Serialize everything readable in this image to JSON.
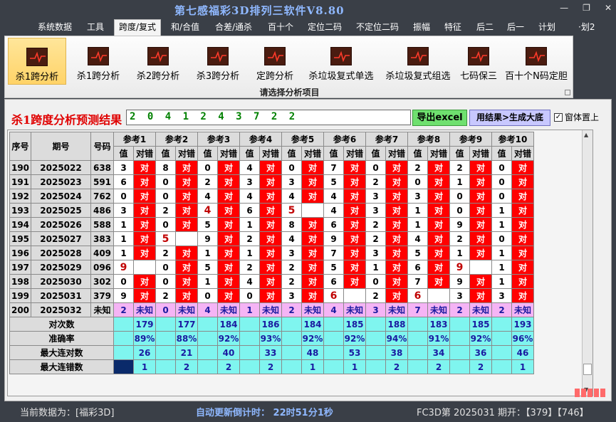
{
  "app_title": "第七感福彩3D排列三软件V8.80",
  "window_controls": [
    "—",
    "❐",
    "✕"
  ],
  "menu": [
    "系统数据",
    "工具",
    "跨度/复式",
    "和/合值",
    "合差/通杀",
    "百十个",
    "定位二码",
    "不定位二码",
    "振幅",
    "特征",
    "后二",
    "后一",
    "计划",
    "·划2"
  ],
  "active_menu_index": 2,
  "ribbon": {
    "buttons": [
      "杀1跨分析",
      "杀1跨分析",
      "杀2跨分析",
      "杀3跨分析",
      "定跨分析",
      "杀垃圾复式单选",
      "杀垃圾复式组选",
      "七码保三",
      "百十个N码定胆"
    ],
    "active_index": 0,
    "caption": "请选择分析项目"
  },
  "result": {
    "title": "杀1跨度分析预测结果",
    "value": "2 0 4 1 2 4 3 7 2 2",
    "export_button": "导出excel",
    "generate_button": "用结果>生成大底",
    "topmost_label": "窗体置上",
    "topmost_checked": true
  },
  "table": {
    "col_serial": "序号",
    "col_period": "期号",
    "col_number": "号码",
    "ref_headers": [
      "参考1",
      "参考2",
      "参考3",
      "参考4",
      "参考5",
      "参考6",
      "参考7",
      "参考8",
      "参考9",
      "参考10"
    ],
    "sub_value": "值",
    "sub_result": "对错",
    "ok_text": "对",
    "rows": [
      {
        "seq": "190",
        "period": "2025022",
        "num": "638",
        "vals": [
          "3",
          "8",
          "0",
          "4",
          "0",
          "7",
          "0",
          "2",
          "2",
          "0"
        ],
        "ok": [
          true,
          true,
          true,
          true,
          true,
          true,
          true,
          true,
          true,
          true
        ]
      },
      {
        "seq": "191",
        "period": "2025023",
        "num": "591",
        "vals": [
          "6",
          "0",
          "2",
          "3",
          "3",
          "5",
          "2",
          "0",
          "1",
          "0"
        ],
        "ok": [
          true,
          true,
          true,
          true,
          true,
          true,
          true,
          true,
          true,
          true
        ]
      },
      {
        "seq": "192",
        "period": "2025024",
        "num": "762",
        "vals": [
          "0",
          "0",
          "4",
          "4",
          "4",
          "4",
          "3",
          "3",
          "0",
          "0"
        ],
        "ok": [
          true,
          true,
          true,
          true,
          true,
          true,
          true,
          true,
          true,
          true
        ]
      },
      {
        "seq": "193",
        "period": "2025025",
        "num": "486",
        "vals": [
          "3",
          "2",
          "4",
          "6",
          "5",
          "4",
          "3",
          "1",
          "0",
          "1"
        ],
        "ok": [
          true,
          true,
          true,
          true,
          false,
          true,
          true,
          true,
          true,
          true
        ],
        "miss": [
          false,
          false,
          true,
          false,
          true,
          false,
          false,
          false,
          false,
          false
        ]
      },
      {
        "seq": "194",
        "period": "2025026",
        "num": "588",
        "vals": [
          "1",
          "0",
          "5",
          "1",
          "8",
          "6",
          "2",
          "1",
          "9",
          "1"
        ],
        "ok": [
          true,
          true,
          true,
          true,
          true,
          true,
          true,
          true,
          true,
          true
        ]
      },
      {
        "seq": "195",
        "period": "2025027",
        "num": "383",
        "vals": [
          "1",
          "5",
          "9",
          "2",
          "4",
          "9",
          "2",
          "4",
          "2",
          "0"
        ],
        "ok": [
          true,
          false,
          true,
          true,
          true,
          true,
          true,
          true,
          true,
          true
        ],
        "miss": [
          false,
          true,
          false,
          false,
          false,
          false,
          false,
          false,
          false,
          false
        ]
      },
      {
        "seq": "196",
        "period": "2025028",
        "num": "409",
        "vals": [
          "1",
          "2",
          "1",
          "1",
          "3",
          "7",
          "3",
          "5",
          "1",
          "1"
        ],
        "ok": [
          true,
          true,
          true,
          true,
          true,
          true,
          true,
          true,
          true,
          true
        ]
      },
      {
        "seq": "197",
        "period": "2025029",
        "num": "096",
        "vals": [
          "9",
          "0",
          "5",
          "2",
          "2",
          "5",
          "1",
          "6",
          "9",
          "1"
        ],
        "ok": [
          false,
          true,
          true,
          true,
          true,
          true,
          true,
          true,
          false,
          true
        ],
        "miss": [
          true,
          false,
          false,
          false,
          false,
          false,
          false,
          false,
          true,
          false
        ]
      },
      {
        "seq": "198",
        "period": "2025030",
        "num": "302",
        "vals": [
          "0",
          "0",
          "1",
          "4",
          "2",
          "6",
          "0",
          "7",
          "9",
          "1"
        ],
        "ok": [
          true,
          true,
          true,
          true,
          true,
          true,
          true,
          true,
          true,
          true
        ]
      },
      {
        "seq": "199",
        "period": "2025031",
        "num": "379",
        "vals": [
          "9",
          "2",
          "0",
          "0",
          "3",
          "6",
          "2",
          "6",
          "3",
          "3"
        ],
        "ok": [
          true,
          true,
          true,
          true,
          true,
          false,
          true,
          false,
          true,
          true
        ],
        "miss": [
          false,
          false,
          false,
          false,
          false,
          true,
          false,
          true,
          false,
          false
        ]
      }
    ],
    "pending_row": {
      "seq": "200",
      "period": "2025032",
      "num": "未知",
      "vals": [
        "2",
        "0",
        "4",
        "1",
        "2",
        "4",
        "3",
        "7",
        "2",
        "2"
      ],
      "unknown": "未知"
    },
    "stats": [
      {
        "label": "对次数",
        "values": [
          "179",
          "177",
          "184",
          "186",
          "184",
          "185",
          "188",
          "183",
          "185",
          "193"
        ]
      },
      {
        "label": "准确率",
        "values": [
          "89%",
          "88%",
          "92%",
          "93%",
          "92%",
          "92%",
          "94%",
          "91%",
          "92%",
          "96%"
        ]
      },
      {
        "label": "最大连对数",
        "values": [
          "26",
          "21",
          "40",
          "33",
          "48",
          "53",
          "38",
          "34",
          "36",
          "46"
        ]
      },
      {
        "label": "最大连错数",
        "values": [
          "1",
          "2",
          "2",
          "2",
          "1",
          "1",
          "2",
          "2",
          "2",
          "1"
        ]
      }
    ]
  },
  "status": {
    "current_data": "当前数据为：[福彩3D]",
    "countdown": "自动更新倒计时：  22时51分1秒",
    "draw_info": "FC3D第 2025031 期开：【379】【746】"
  },
  "colors": {
    "ok_cell": "#ff0000",
    "pending_cell": "#f5b4f5",
    "stat_cell": "#7ff5ef",
    "title_red": "#e00000",
    "app_title": "#8fb8ff"
  }
}
